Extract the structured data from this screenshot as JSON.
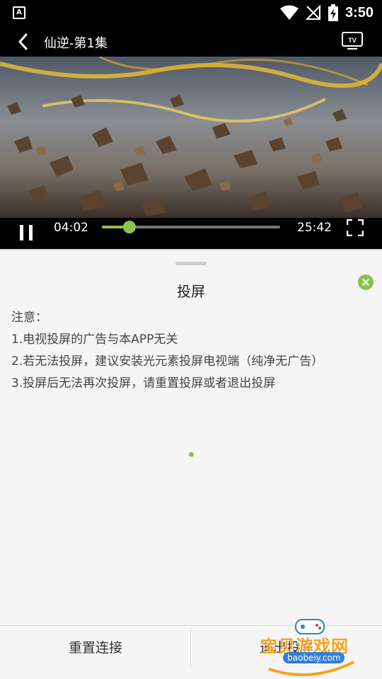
{
  "status_bar": {
    "app_badge": "A",
    "time": "3:50",
    "icons": [
      "wifi-icon",
      "no-signal-icon",
      "battery-charging-icon"
    ]
  },
  "header": {
    "title": "仙逆-第1集",
    "back_icon": "chevron-left-icon",
    "cast_icon": "tv-icon"
  },
  "player": {
    "current_time": "04:02",
    "total_time": "25:42",
    "progress": 0.156,
    "accent_color": "#8bc34a",
    "state": "playing"
  },
  "sheet": {
    "title": "投屏",
    "notes": [
      "注意：",
      "1.电视投屏的广告与本APP无关",
      "2.若无法投屏，建议安装光元素投屏电视端（纯净无广告）",
      "3.投屏后无法再次投屏，请重置投屏或者退出投屏"
    ]
  },
  "footer": {
    "reset_label": "重置连接",
    "exit_label": "退出投屏"
  },
  "watermark": {
    "text": "宝贝游戏网",
    "url": "baobeiy.com"
  }
}
